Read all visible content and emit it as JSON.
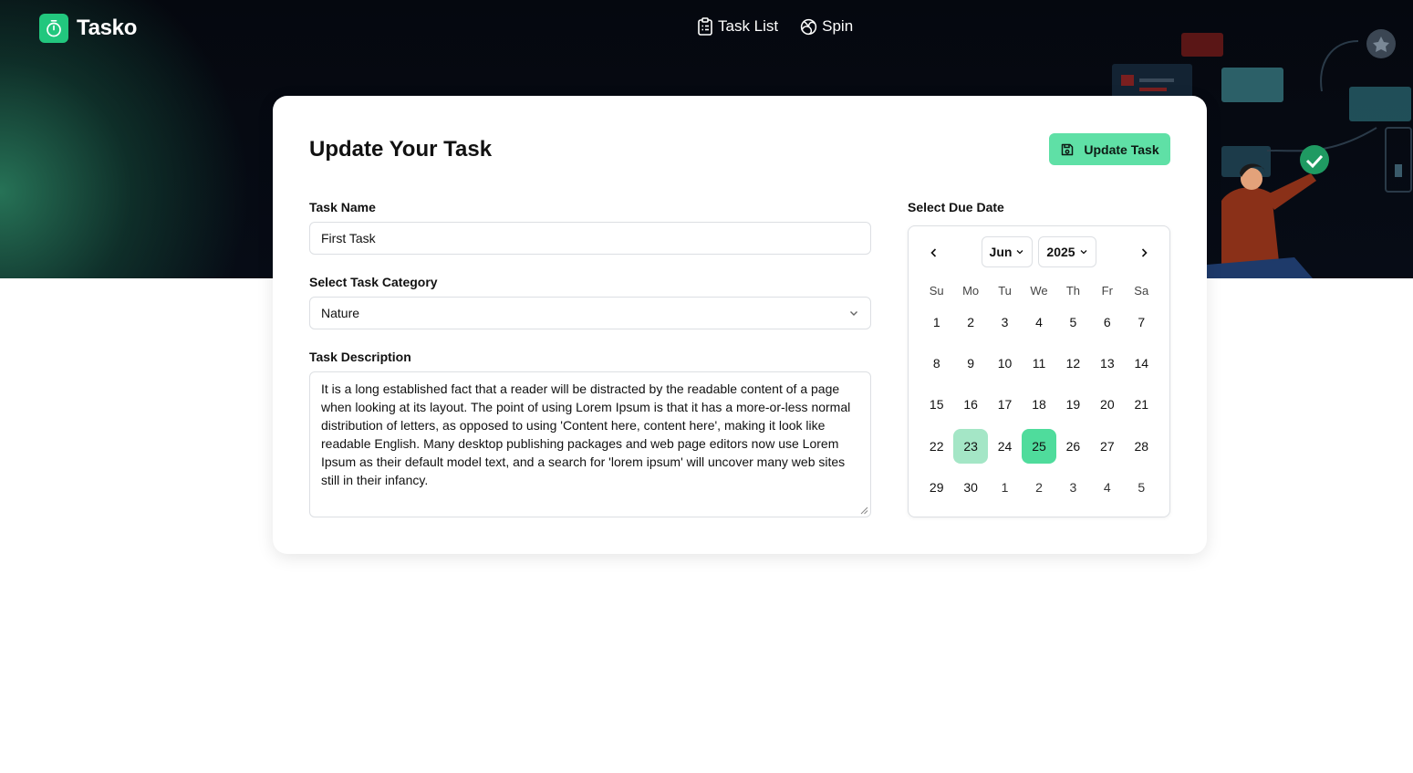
{
  "brand": {
    "name": "Tasko"
  },
  "nav": {
    "items": [
      {
        "label": "Task List",
        "icon": "clipboard-icon"
      },
      {
        "label": "Spin",
        "icon": "spin-icon"
      }
    ]
  },
  "page": {
    "title": "Update Your Task",
    "update_button_label": "Update Task"
  },
  "form": {
    "task_name_label": "Task Name",
    "task_name_value": "First Task",
    "category_label": "Select Task Category",
    "category_value": "Nature",
    "description_label": "Task Description",
    "description_value": "It is a long established fact that a reader will be distracted by the readable content of a page when looking at its layout. The point of using Lorem Ipsum is that it has a more-or-less normal distribution of letters, as opposed to using 'Content here, content here', making it look like readable English. Many desktop publishing packages and web page editors now use Lorem Ipsum as their default model text, and a search for 'lorem ipsum' will uncover many web sites still in their infancy."
  },
  "calendar": {
    "label": "Select Due Date",
    "month": "Jun",
    "year": "2025",
    "weekdays": [
      "Su",
      "Mo",
      "Tu",
      "We",
      "Th",
      "Fr",
      "Sa"
    ],
    "weeks": [
      [
        "1",
        "2",
        "3",
        "4",
        "5",
        "6",
        "7"
      ],
      [
        "8",
        "9",
        "10",
        "11",
        "12",
        "13",
        "14"
      ],
      [
        "15",
        "16",
        "17",
        "18",
        "19",
        "20",
        "21"
      ],
      [
        "22",
        "23",
        "24",
        "25",
        "26",
        "27",
        "28"
      ],
      [
        "29",
        "30",
        "1",
        "2",
        "3",
        "4",
        "5"
      ]
    ],
    "today": "23",
    "selected": "25"
  },
  "colors": {
    "accent": "#5fe0a6",
    "selected_day": "#4fdc9c",
    "today_day": "#a4e6c6",
    "header_bg": "#05080f"
  }
}
